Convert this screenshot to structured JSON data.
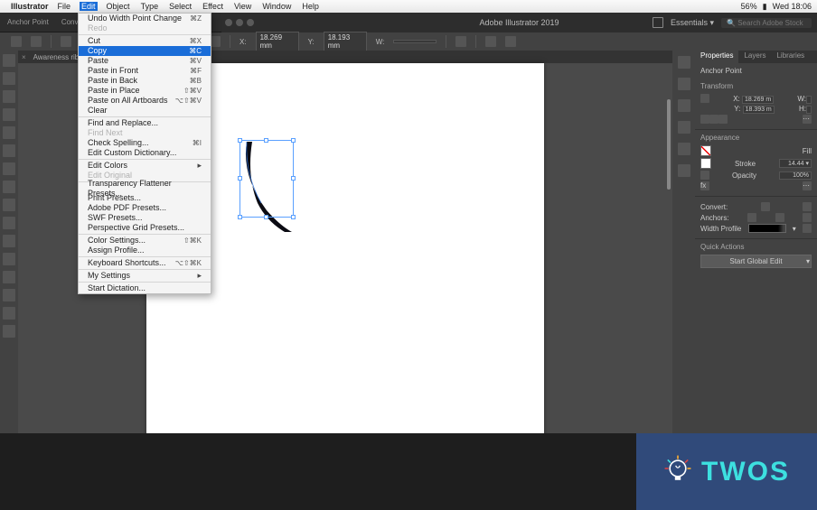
{
  "macos_menubar": {
    "app_name": "Illustrator",
    "items": [
      "File",
      "Edit",
      "Object",
      "Type",
      "Select",
      "Effect",
      "View",
      "Window",
      "Help"
    ],
    "active_index": 1,
    "status": {
      "battery_pct": "56%",
      "day_time": "Wed 18:06"
    }
  },
  "title_bar": {
    "title": "Adobe Illustrator 2019",
    "workspace": "Essentials",
    "search_placeholder": "Search Adobe Stock"
  },
  "control_bar": {
    "label1": "Anchor Point",
    "label2": "Convert:"
  },
  "tab": {
    "name": "Awareness ribbon.ai"
  },
  "toolbar": {
    "x_label": "X:",
    "x_value": "18.269 mm",
    "y_label": "Y:",
    "y_value": "18.193 mm",
    "w_label": "W:"
  },
  "edit_menu": {
    "undo": "Undo Width Point Change",
    "undo_sc": "⌘Z",
    "redo": "Redo",
    "cut": "Cut",
    "cut_sc": "⌘X",
    "copy": "Copy",
    "copy_sc": "⌘C",
    "paste": "Paste",
    "paste_sc": "⌘V",
    "paste_front": "Paste in Front",
    "paste_front_sc": "⌘F",
    "paste_back": "Paste in Back",
    "paste_back_sc": "⌘B",
    "paste_place": "Paste in Place",
    "paste_place_sc": "⇧⌘V",
    "paste_artboards": "Paste on All Artboards",
    "paste_artboards_sc": "⌥⇧⌘V",
    "clear": "Clear",
    "find_replace": "Find and Replace...",
    "find_next": "Find Next",
    "check_spell": "Check Spelling...",
    "check_spell_sc": "⌘I",
    "edit_dict": "Edit Custom Dictionary...",
    "edit_colors": "Edit Colors",
    "edit_original": "Edit Original",
    "trans_flat": "Transparency Flattener Presets...",
    "print_presets": "Print Presets...",
    "pdf_presets": "Adobe PDF Presets...",
    "swf_presets": "SWF Presets...",
    "persp_grid": "Perspective Grid Presets...",
    "color_settings": "Color Settings...",
    "color_settings_sc": "⇧⌘K",
    "assign_profile": "Assign Profile...",
    "kbd_shortcuts": "Keyboard Shortcuts...",
    "kbd_shortcuts_sc": "⌥⇧⌘K",
    "my_settings": "My Settings",
    "start_dict": "Start Dictation..."
  },
  "right_panel": {
    "tabs": [
      "Properties",
      "Layers",
      "Libraries"
    ],
    "selection_type": "Anchor Point",
    "transform_title": "Transform",
    "x_label": "X:",
    "x_value": "18.269 m",
    "y_label": "Y:",
    "y_value": "18.393 m",
    "w_label": "W:",
    "h_label": "H:",
    "appearance_title": "Appearance",
    "fill_label": "Fill",
    "stroke_label": "Stroke",
    "stroke_value": "14.44 ▾",
    "opacity_label": "Opacity",
    "opacity_value": "100%",
    "convert_label": "Convert:",
    "anchors_label": "Anchors:",
    "width_profile_label": "Width Profile",
    "quick_actions_title": "Quick Actions",
    "start_global_edit": "Start Global Edit"
  },
  "watermark": {
    "text": "TWOS"
  }
}
